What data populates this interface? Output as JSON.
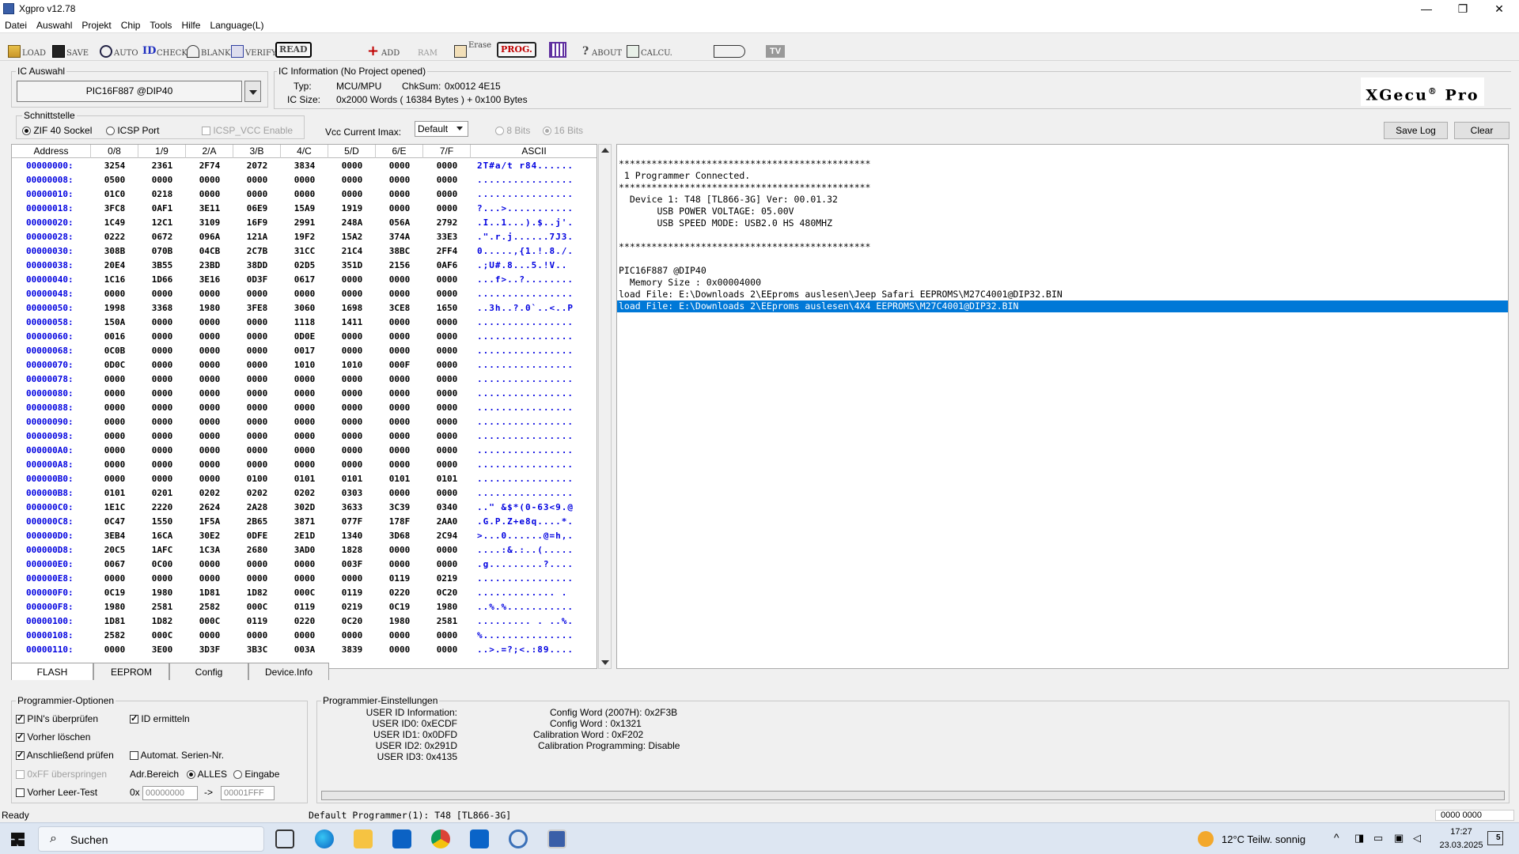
{
  "window": {
    "title": "Xgpro v12.78",
    "min": "—",
    "max": "❐",
    "close": "✕"
  },
  "menu": [
    "Datei",
    "Auswahl",
    "Projekt",
    "Chip",
    "Tools",
    "Hilfe",
    "Language(L)"
  ],
  "toolbar": {
    "load": "LOAD",
    "save": "SAVE",
    "auto": "AUTO",
    "check": "CHECK",
    "blank": "BLANK",
    "verify": "VERIFY",
    "read": "READ",
    "add": "ADD",
    "ram": "RAM",
    "erase": "Erase",
    "prog": "PROG.",
    "about": "ABOUT",
    "calcu": "CALCU.",
    "tv": "TV"
  },
  "ic_select": {
    "title": "IC Auswahl",
    "value": "PIC16F887 @DIP40"
  },
  "ic_info": {
    "title": "IC Information (No Project opened)",
    "typ_label": "Typ:",
    "typ_value": "MCU/MPU",
    "chksum_label": "ChkSum:",
    "chksum_value": "0x0012 4E15",
    "size_label": "IC Size:",
    "size_value": "0x2000 Words ( 16384 Bytes ) + 0x100 Bytes"
  },
  "logo": {
    "text": "XGecu",
    "sup": "®",
    "suffix": " Pro"
  },
  "interface": {
    "title": "Schnittstelle",
    "zif": "ZIF 40 Sockel",
    "icsp": "ICSP Port",
    "icsp_vcc": "ICSP_VCC Enable"
  },
  "vcc": {
    "label": "Vcc Current Imax:",
    "value": "Default",
    "bits8": "8 Bits",
    "bits16": "16 Bits"
  },
  "log_buttons": {
    "save": "Save Log",
    "clear": "Clear"
  },
  "hex": {
    "headers": [
      "Address",
      "0/8",
      "1/9",
      "2/A",
      "3/B",
      "4/C",
      "5/D",
      "6/E",
      "7/F",
      "ASCII"
    ],
    "rows": [
      [
        "00000000:",
        "3254",
        "2361",
        "2F74",
        "2072",
        "3834",
        "0000",
        "0000",
        "0000",
        "2T#a/t r84......"
      ],
      [
        "00000008:",
        "0500",
        "0000",
        "0000",
        "0000",
        "0000",
        "0000",
        "0000",
        "0000",
        "................"
      ],
      [
        "00000010:",
        "01C0",
        "0218",
        "0000",
        "0000",
        "0000",
        "0000",
        "0000",
        "0000",
        "................"
      ],
      [
        "00000018:",
        "3FC8",
        "0AF1",
        "3E11",
        "06E9",
        "15A9",
        "1919",
        "0000",
        "0000",
        "?...>..........."
      ],
      [
        "00000020:",
        "1C49",
        "12C1",
        "3109",
        "16F9",
        "2991",
        "248A",
        "056A",
        "2792",
        ".I..1...).$..j'."
      ],
      [
        "00000028:",
        "0222",
        "0672",
        "096A",
        "121A",
        "19F2",
        "15A2",
        "374A",
        "33E3",
        ".\".r.j......7J3."
      ],
      [
        "00000030:",
        "308B",
        "070B",
        "04CB",
        "2C7B",
        "31CC",
        "21C4",
        "38BC",
        "2FF4",
        "0.....,{1.!.8./."
      ],
      [
        "00000038:",
        "20E4",
        "3B55",
        "23BD",
        "38DD",
        "02D5",
        "351D",
        "2156",
        "0AF6",
        " .;U#.8...5.!V.."
      ],
      [
        "00000040:",
        "1C16",
        "1D66",
        "3E16",
        "0D3F",
        "0617",
        "0000",
        "0000",
        "0000",
        "...f>..?........"
      ],
      [
        "00000048:",
        "0000",
        "0000",
        "0000",
        "0000",
        "0000",
        "0000",
        "0000",
        "0000",
        "................"
      ],
      [
        "00000050:",
        "1998",
        "3368",
        "1980",
        "3FE8",
        "3060",
        "1698",
        "3CE8",
        "1650",
        "..3h..?.0`..<..P"
      ],
      [
        "00000058:",
        "150A",
        "0000",
        "0000",
        "0000",
        "1118",
        "1411",
        "0000",
        "0000",
        "................"
      ],
      [
        "00000060:",
        "0016",
        "0000",
        "0000",
        "0000",
        "0D0E",
        "0000",
        "0000",
        "0000",
        "................"
      ],
      [
        "00000068:",
        "0C0B",
        "0000",
        "0000",
        "0000",
        "0017",
        "0000",
        "0000",
        "0000",
        "................"
      ],
      [
        "00000070:",
        "0D0C",
        "0000",
        "0000",
        "0000",
        "1010",
        "1010",
        "000F",
        "0000",
        "................"
      ],
      [
        "00000078:",
        "0000",
        "0000",
        "0000",
        "0000",
        "0000",
        "0000",
        "0000",
        "0000",
        "................"
      ],
      [
        "00000080:",
        "0000",
        "0000",
        "0000",
        "0000",
        "0000",
        "0000",
        "0000",
        "0000",
        "................"
      ],
      [
        "00000088:",
        "0000",
        "0000",
        "0000",
        "0000",
        "0000",
        "0000",
        "0000",
        "0000",
        "................"
      ],
      [
        "00000090:",
        "0000",
        "0000",
        "0000",
        "0000",
        "0000",
        "0000",
        "0000",
        "0000",
        "................"
      ],
      [
        "00000098:",
        "0000",
        "0000",
        "0000",
        "0000",
        "0000",
        "0000",
        "0000",
        "0000",
        "................"
      ],
      [
        "000000A0:",
        "0000",
        "0000",
        "0000",
        "0000",
        "0000",
        "0000",
        "0000",
        "0000",
        "................"
      ],
      [
        "000000A8:",
        "0000",
        "0000",
        "0000",
        "0000",
        "0000",
        "0000",
        "0000",
        "0000",
        "................"
      ],
      [
        "000000B0:",
        "0000",
        "0000",
        "0000",
        "0100",
        "0101",
        "0101",
        "0101",
        "0101",
        "................"
      ],
      [
        "000000B8:",
        "0101",
        "0201",
        "0202",
        "0202",
        "0202",
        "0303",
        "0000",
        "0000",
        "................"
      ],
      [
        "000000C0:",
        "1E1C",
        "2220",
        "2624",
        "2A28",
        "302D",
        "3633",
        "3C39",
        "0340",
        "..\" &$*(0-63<9.@"
      ],
      [
        "000000C8:",
        "0C47",
        "1550",
        "1F5A",
        "2B65",
        "3871",
        "077F",
        "178F",
        "2AA0",
        ".G.P.Z+e8q....*."
      ],
      [
        "000000D0:",
        "3EB4",
        "16CA",
        "30E2",
        "0DFE",
        "2E1D",
        "1340",
        "3D68",
        "2C94",
        ">...0......@=h,."
      ],
      [
        "000000D8:",
        "20C5",
        "1AFC",
        "1C3A",
        "2680",
        "3AD0",
        "1828",
        "0000",
        "0000",
        " ....:&.:..(....."
      ],
      [
        "000000E0:",
        "0067",
        "0C00",
        "0000",
        "0000",
        "0000",
        "003F",
        "0000",
        "0000",
        ".g.........?...."
      ],
      [
        "000000E8:",
        "0000",
        "0000",
        "0000",
        "0000",
        "0000",
        "0000",
        "0119",
        "0219",
        "................"
      ],
      [
        "000000F0:",
        "0C19",
        "1980",
        "1D81",
        "1D82",
        "000C",
        "0119",
        "0220",
        "0C20",
        "............. . "
      ],
      [
        "000000F8:",
        "1980",
        "2581",
        "2582",
        "000C",
        "0119",
        "0219",
        "0C19",
        "1980",
        "..%.%..........."
      ],
      [
        "00000100:",
        "1D81",
        "1D82",
        "000C",
        "0119",
        "0220",
        "0C20",
        "1980",
        "2581",
        "......... . ..%."
      ],
      [
        "00000108:",
        "2582",
        "000C",
        "0000",
        "0000",
        "0000",
        "0000",
        "0000",
        "0000",
        "%..............."
      ],
      [
        "00000110:",
        "0000",
        "3E00",
        "3D3F",
        "3B3C",
        "003A",
        "3839",
        "0000",
        "0000",
        "..>.=?;<.:89...."
      ]
    ]
  },
  "log": {
    "lines": [
      "**********************************************",
      " 1 Programmer Connected.",
      "**********************************************",
      "  Device 1: T48 [TL866-3G] Ver: 00.01.32",
      "       USB POWER VOLTAGE: 05.00V",
      "       USB SPEED MODE: USB2.0 HS 480MHZ",
      "",
      "**********************************************",
      "",
      "PIC16F887 @DIP40",
      "  Memory Size : 0x00004000",
      "load File: E:\\Downloads 2\\EEproms auslesen\\Jeep Safari EEPROMS\\M27C4001@DIP32.BIN",
      "load File: E:\\Downloads 2\\EEproms auslesen\\4X4 EEPROMS\\M27C4001@DIP32.BIN"
    ]
  },
  "tabs": [
    "FLASH",
    "EEPROM",
    "Config",
    "Device.Info"
  ],
  "prog_options": {
    "title": "Programmier-Optionen",
    "pin_check": "PIN's überprüfen",
    "id_detect": "ID ermitteln",
    "erase_before": "Vorher löschen",
    "verify_after": "Anschließend prüfen",
    "auto_serial": "Automat. Serien-Nr.",
    "skip_ff": "0xFF überspringen",
    "adr_label": "Adr.Bereich",
    "all": "ALLES",
    "input": "Eingabe",
    "blank_before": "Vorher Leer-Test",
    "hex_prefix": "0x",
    "from": "00000000",
    "arrow": "->",
    "to": "00001FFF"
  },
  "prog_settings": {
    "title": "Programmier-Einstellungen",
    "left": [
      "USER ID Information:",
      "USER ID0: 0xECDF",
      "USER ID1: 0x0DFD",
      "USER ID2: 0x291D",
      "USER ID3: 0x4135"
    ],
    "right": [
      "Config Word (2007H): 0x2F3B",
      "Config Word : 0x1321",
      "Calibration Word : 0xF202",
      "Calibration Programming: Disable"
    ]
  },
  "status": {
    "left": "Ready",
    "center": "Default Programmer(1): T48 [TL866-3G]",
    "right": "0000 0000"
  },
  "taskbar": {
    "search": "Suchen",
    "weather": "12°C  Teilw. sonnig",
    "time": "17:27",
    "date": "23.03.2025",
    "notif": "5"
  },
  "colors": {
    "accent": "#0078d7",
    "hex_blue": "#0000e0"
  }
}
